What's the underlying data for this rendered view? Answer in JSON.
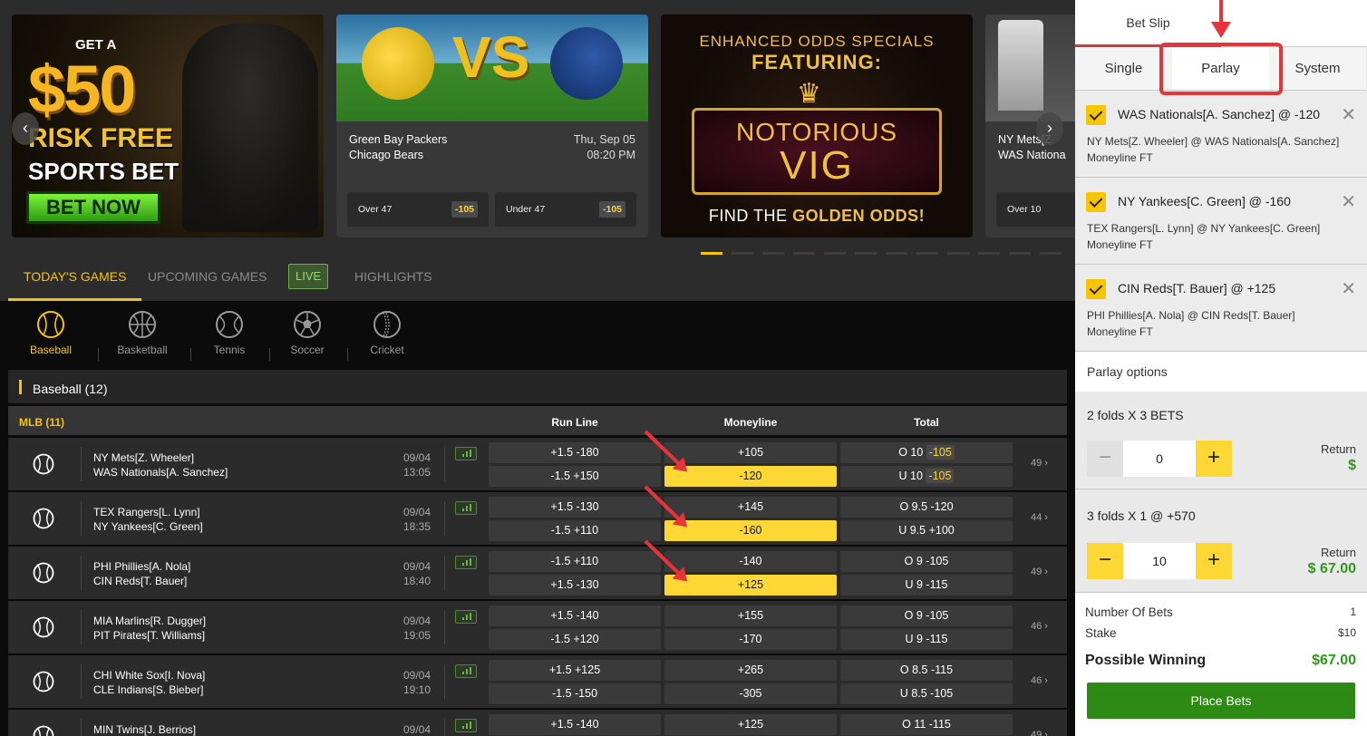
{
  "banners": {
    "promo1": {
      "line1": "GET A",
      "line2": "$50",
      "line3": "RISK FREE",
      "line4": "SPORTS BET",
      "button": "BET NOW"
    },
    "game1": {
      "team1": "Green Bay Packers",
      "team2": "Chicago Bears",
      "date": "Thu, Sep 05",
      "time": "08:20 PM",
      "vs": "VS",
      "over_label": "Over 47",
      "over_odds": "-105",
      "under_label": "Under 47",
      "under_odds": "-105"
    },
    "promo2": {
      "line1": "ENHANCED ODDS SPECIALS",
      "line2": "FEATURING:",
      "name1": "NOTORIOUS",
      "name2": "VIG",
      "footer_pre": "FIND THE",
      "footer_hl": "GOLDEN ODDS!"
    },
    "game2": {
      "team1": "NY Mets[Z",
      "team2": "WAS Nationa",
      "over_label": "Over 10"
    },
    "prev": "‹",
    "next": "›"
  },
  "tabs": {
    "today": "TODAY'S GAMES",
    "upcoming": "UPCOMING GAMES",
    "live": "LIVE",
    "highlights": "HIGHLIGHTS"
  },
  "sports": {
    "baseball": "Baseball",
    "basketball": "Basketball",
    "tennis": "Tennis",
    "soccer": "Soccer",
    "cricket": "Cricket"
  },
  "category": {
    "title": "Baseball  (12)"
  },
  "league": {
    "title": "MLB  (11)",
    "col_runline": "Run Line",
    "col_moneyline": "Moneyline",
    "col_total": "Total"
  },
  "games": [
    {
      "team1": "NY Mets[Z. Wheeler]",
      "team2": "WAS Nationals[A. Sanchez]",
      "date": "09/04",
      "time": "13:05",
      "rl1": "+1.5  -180",
      "rl2": "-1.5  +150",
      "ml1": "+105",
      "ml2": "-120",
      "t1a": "O 10",
      "t1b": "-105",
      "t2a": "U 10",
      "t2b": "-105",
      "more": "49 ›"
    },
    {
      "team1": "TEX Rangers[L. Lynn]",
      "team2": "NY Yankees[C. Green]",
      "date": "09/04",
      "time": "18:35",
      "rl1": "+1.5  -130",
      "rl2": "-1.5  +110",
      "ml1": "+145",
      "ml2": "-160",
      "t1": "O 9.5  -120",
      "t2": "U 9.5  +100",
      "more": "44 ›"
    },
    {
      "team1": "PHI Phillies[A. Nola]",
      "team2": "CIN Reds[T. Bauer]",
      "date": "09/04",
      "time": "18:40",
      "rl1": "-1.5  +110",
      "rl2": "+1.5  -130",
      "ml1": "-140",
      "ml2": "+125",
      "t1": "O 9  -105",
      "t2": "U 9  -115",
      "more": "49 ›"
    },
    {
      "team1": "MIA Marlins[R. Dugger]",
      "team2": "PIT Pirates[T. Williams]",
      "date": "09/04",
      "time": "19:05",
      "rl1": "+1.5  -140",
      "rl2": "-1.5  +120",
      "ml1": "+155",
      "ml2": "-170",
      "t1": "O 9  -105",
      "t2": "U 9  -115",
      "more": "46 ›"
    },
    {
      "team1": "CHI White Sox[I. Nova]",
      "team2": "CLE Indians[S. Bieber]",
      "date": "09/04",
      "time": "19:10",
      "rl1": "+1.5  +125",
      "rl2": "-1.5  -150",
      "ml1": "+265",
      "ml2": "-305",
      "t1": "O 8.5  -115",
      "t2": "U 8.5  -105",
      "more": "46 ›"
    },
    {
      "team1": "MIN Twins[J. Berrios]",
      "team2": "",
      "date": "09/04",
      "time": "",
      "rl1": "+1.5  -140",
      "rl2": "",
      "ml1": "+125",
      "ml2": "",
      "t1": "O 11  -115",
      "t2": "",
      "more": "49 ›"
    }
  ],
  "slip": {
    "title": "Bet Slip",
    "tabs": {
      "single": "Single",
      "parlay": "Parlay",
      "system": "System"
    },
    "bets": [
      {
        "title": "WAS Nationals[A. Sanchez] @ -120",
        "match": "NY Mets[Z. Wheeler]  @  WAS Nationals[A. Sanchez]",
        "market": "Moneyline FT"
      },
      {
        "title": "NY Yankees[C. Green] @ -160",
        "match": "TEX Rangers[L. Lynn]  @  NY Yankees[C. Green]",
        "market": "Moneyline FT"
      },
      {
        "title": "CIN Reds[T. Bauer] @ +125",
        "match": "PHI Phillies[A. Nola]  @  CIN Reds[T. Bauer]",
        "market": "Moneyline FT"
      }
    ],
    "close": "✕",
    "parlay_options": "Parlay options",
    "fold1": {
      "label": "2 folds  X  3 BETS",
      "minus": "−",
      "value": "0",
      "plus": "+",
      "return_label": "Return",
      "return_value": "$"
    },
    "fold2": {
      "label": "3 folds  X  1  @  +570",
      "minus": "−",
      "value": "10",
      "plus": "+",
      "return_label": "Return",
      "return_value": "$ 67.00"
    },
    "summary": {
      "num_bets_label": "Number Of Bets",
      "num_bets": "1",
      "stake_label": "Stake",
      "stake": "$10",
      "winning_label": "Possible Winning",
      "winning": "$67.00",
      "place": "Place Bets"
    }
  },
  "colors": {
    "accent": "#f7c600",
    "selected": "#fdd835",
    "annotation": "#e8333a",
    "success": "#2e9a1a"
  }
}
